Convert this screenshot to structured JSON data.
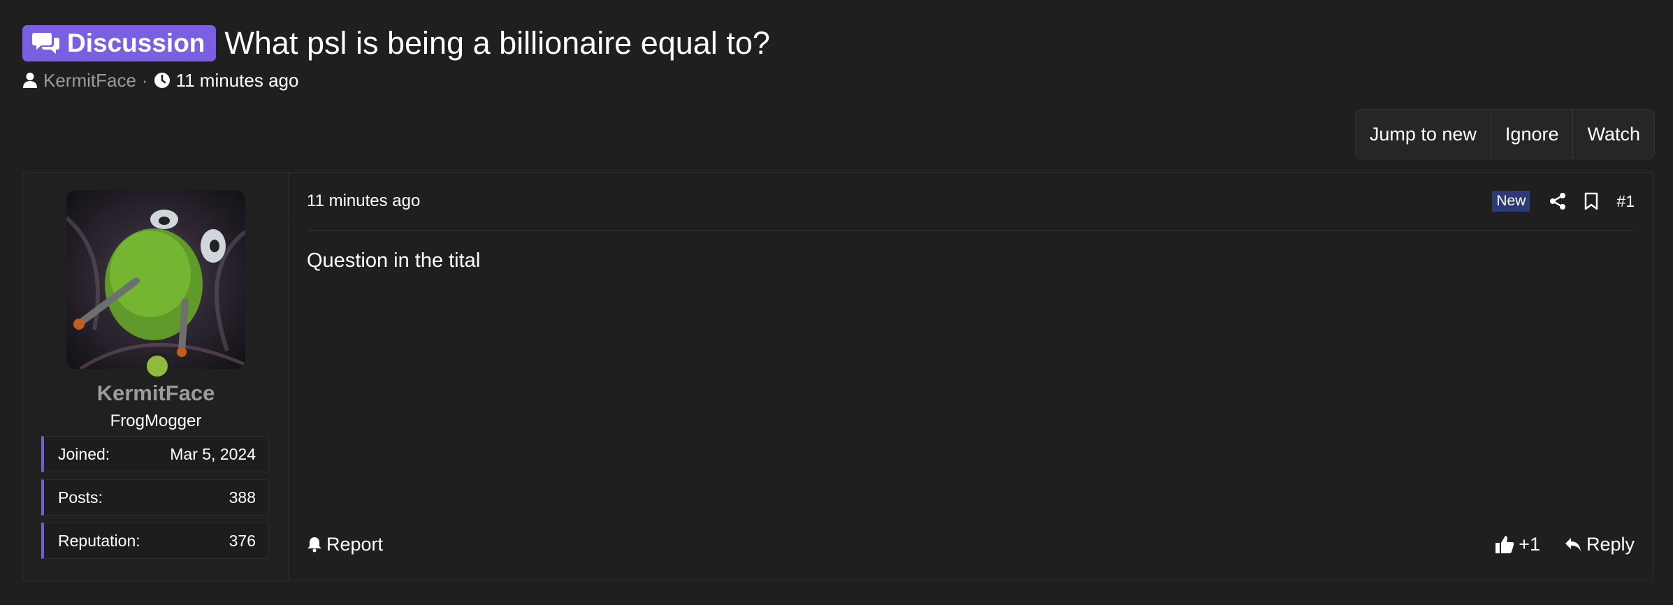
{
  "thread": {
    "prefix_label": "Discussion",
    "title": "What psl is being a billionaire equal to?",
    "author": "KermitFace",
    "separator": "·",
    "time": "11 minutes ago"
  },
  "thread_actions": {
    "jump_label": "Jump to new",
    "ignore_label": "Ignore",
    "watch_label": "Watch"
  },
  "post": {
    "date": "11 minutes ago",
    "badge": "New",
    "number": "#1",
    "body": "Question in the tital",
    "report_label": "Report",
    "reaction_count": "+1",
    "reply_label": "Reply"
  },
  "user": {
    "name": "KermitFace",
    "title": "FrogMogger",
    "stats": [
      {
        "label": "Joined:",
        "value": "Mar 5, 2024"
      },
      {
        "label": "Posts:",
        "value": "388"
      },
      {
        "label": "Reputation:",
        "value": "376"
      }
    ]
  },
  "colors": {
    "background": "#1f1f1f",
    "prefix": "#7a5fe0",
    "stat_accent": "#6b66c9",
    "online": "#8fba3a",
    "new_badge": "#2d3a75",
    "muted_text": "#9b9b9b"
  },
  "icons": {
    "prefix": "chat-bubbles-icon",
    "author": "user-icon",
    "time": "clock-icon",
    "share": "share-icon",
    "bookmark": "bookmark-icon",
    "report": "bell-icon",
    "like": "thumbs-up-icon",
    "reply": "reply-icon"
  }
}
